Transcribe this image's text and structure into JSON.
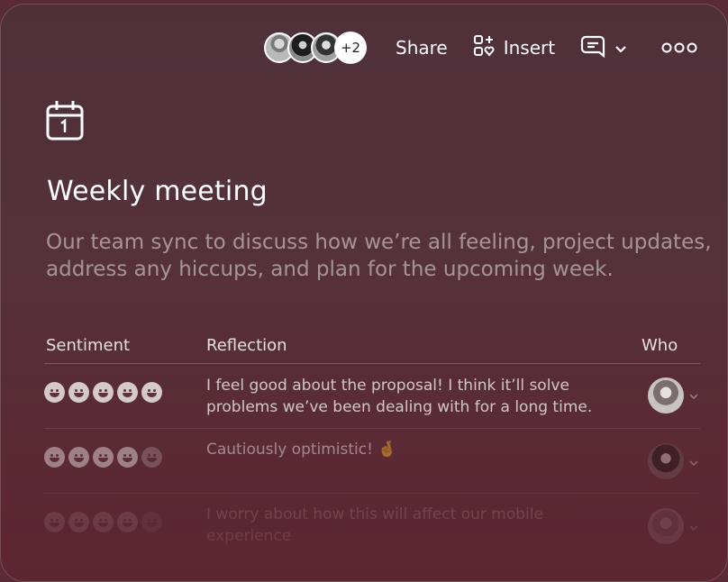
{
  "toolbar": {
    "collaborators_more": "+2",
    "share_label": "Share",
    "insert_label": "Insert"
  },
  "page": {
    "title": "Weekly meeting",
    "description": "Our team sync to discuss how we’re all feeling, project updates, address any hiccups, and plan for the upcoming week."
  },
  "table": {
    "columns": [
      "Sentiment",
      "Reflection",
      "Who"
    ],
    "rows": [
      {
        "sentiment": 5,
        "reflection": "I feel good about the proposal! I think it’ll solve problems we’ve been dealing with for a long time."
      },
      {
        "sentiment": 4,
        "reflection": "Cautiously optimistic! 🤞"
      },
      {
        "sentiment": 4,
        "reflection": "I worry about how this will affect our mobile experience"
      }
    ]
  },
  "colors": {
    "background": "#5a2b36",
    "text": "#ffffff"
  }
}
